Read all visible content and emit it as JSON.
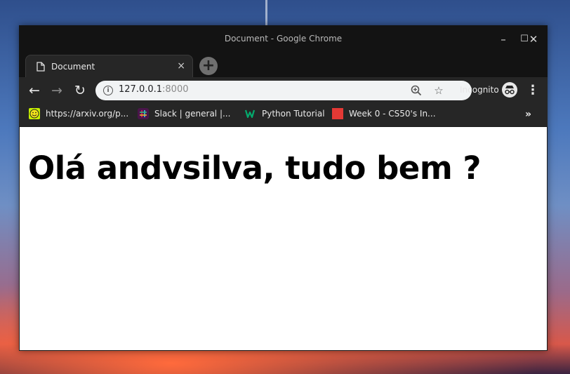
{
  "window": {
    "title": "Document - Google Chrome",
    "controls": {
      "minimize": "–",
      "maximize": "☐",
      "close": "✕"
    }
  },
  "tabs": [
    {
      "title": "Document",
      "close": "×",
      "active": true
    }
  ],
  "new_tab": "+",
  "toolbar": {
    "back": "←",
    "forward": "→",
    "reload": "↻",
    "url_host": "127.0.0.1",
    "url_port": ":8000",
    "zoom_icon": "zoom-icon",
    "star_icon": "bookmark-star-icon",
    "incognito_label": "Incognito",
    "menu": "⋮"
  },
  "bookmarks": [
    {
      "label": "https://arxiv.org/p...",
      "icon": "smiley-icon",
      "color": "#c8f000"
    },
    {
      "label": "Slack | general |...",
      "icon": "slack-icon",
      "color": "#4a154b"
    },
    {
      "label": "Python Tutorial",
      "icon": "w3schools-icon",
      "color": "#04aa6d"
    },
    {
      "label": "Week 0 - CS50's In...",
      "icon": "red-square-icon",
      "color": "#e53935"
    }
  ],
  "bookmarks_more": "»",
  "page": {
    "heading": "Olá andvsilva, tudo bem ?"
  }
}
